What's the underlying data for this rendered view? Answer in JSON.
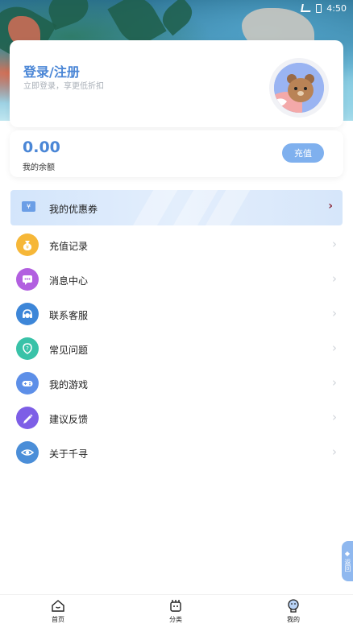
{
  "status_bar": {
    "time": "4:50"
  },
  "profile": {
    "title": "登录/注册",
    "subtitle": "立即登录，享更低折扣"
  },
  "balance": {
    "value": "0.00",
    "label": "我的余额",
    "recharge_button": "充值"
  },
  "coupon": {
    "label": "我的优惠券",
    "icon_text": "¥",
    "arrow": "›"
  },
  "menu": {
    "items": [
      {
        "label": "充值记录",
        "icon": "money-bag-icon",
        "color": "#f6b738"
      },
      {
        "label": "消息中心",
        "icon": "message-icon",
        "color": "#b25fe0"
      },
      {
        "label": "联系客服",
        "icon": "headset-icon",
        "color": "#3d86d8"
      },
      {
        "label": "常见问题",
        "icon": "help-icon",
        "color": "#39c2a8"
      },
      {
        "label": "我的游戏",
        "icon": "gamepad-icon",
        "color": "#5d8fe8"
      },
      {
        "label": "建议反馈",
        "icon": "pen-icon",
        "color": "#7d5ee6"
      },
      {
        "label": "关于千寻",
        "icon": "eye-icon",
        "color": "#4b8ed8"
      }
    ],
    "arrow": "›"
  },
  "float_tab": {
    "label": "返回"
  },
  "tabbar": {
    "tabs": [
      {
        "label": "首页",
        "icon": "home-icon"
      },
      {
        "label": "分类",
        "icon": "category-icon"
      },
      {
        "label": "我的",
        "icon": "profile-icon"
      }
    ]
  },
  "colors": {
    "accent": "#4a86d6",
    "button": "#7fb0ee"
  }
}
